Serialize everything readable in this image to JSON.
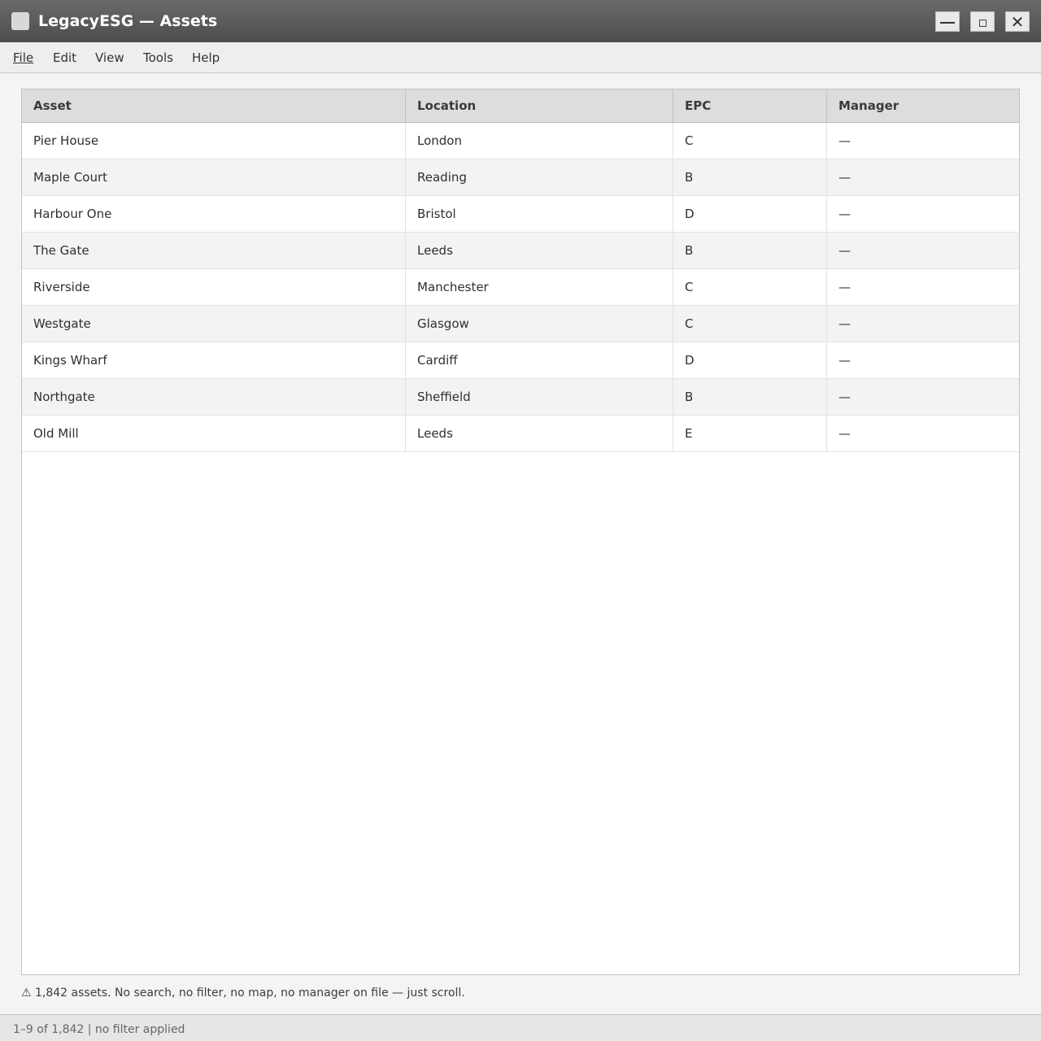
{
  "window": {
    "title": "LegacyESG — Assets"
  },
  "menu": {
    "items": [
      "File",
      "Edit",
      "View",
      "Tools",
      "Help"
    ]
  },
  "table": {
    "columns": [
      "Asset",
      "Location",
      "EPC",
      "Manager"
    ],
    "rows": [
      {
        "asset": "Pier House",
        "location": "London",
        "epc": "C",
        "manager": "—"
      },
      {
        "asset": "Maple Court",
        "location": "Reading",
        "epc": "B",
        "manager": "—"
      },
      {
        "asset": "Harbour One",
        "location": "Bristol",
        "epc": "D",
        "manager": "—"
      },
      {
        "asset": "The Gate",
        "location": "Leeds",
        "epc": "B",
        "manager": "—"
      },
      {
        "asset": "Riverside",
        "location": "Manchester",
        "epc": "C",
        "manager": "—"
      },
      {
        "asset": "Westgate",
        "location": "Glasgow",
        "epc": "C",
        "manager": "—"
      },
      {
        "asset": "Kings Wharf",
        "location": "Cardiff",
        "epc": "D",
        "manager": "—"
      },
      {
        "asset": "Northgate",
        "location": "Sheffield",
        "epc": "B",
        "manager": "—"
      },
      {
        "asset": "Old Mill",
        "location": "Leeds",
        "epc": "E",
        "manager": "—"
      }
    ]
  },
  "notice": {
    "icon": "warning-icon",
    "text": "⚠ 1,842 assets. No search, no filter, no map, no manager on file — just scroll."
  },
  "status": {
    "text": "1–9 of 1,842 | no filter applied"
  }
}
